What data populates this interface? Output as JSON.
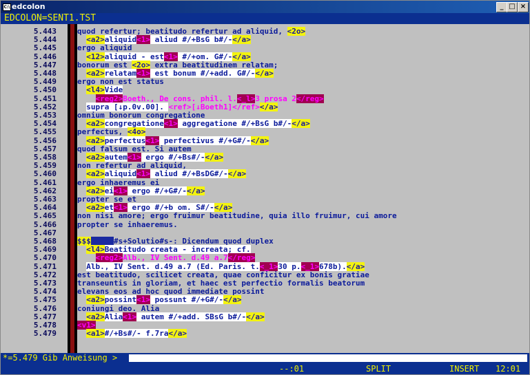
{
  "window": {
    "title": "edcolon",
    "icon_label": "C:\\",
    "controls": [
      "_",
      "□",
      "×"
    ]
  },
  "status_line": "EDCOLON=SENT1.TST",
  "lines": [
    {
      "num": "5.443",
      "segs": [
        {
          "s": "n",
          "t": "quod refertur; beatitudo refertur ad aliquid, "
        },
        {
          "s": "y",
          "t": "<2o>"
        }
      ]
    },
    {
      "num": "5.444",
      "segs": [
        {
          "s": "n",
          "t": "  "
        },
        {
          "s": "y",
          "t": "<a2>"
        },
        {
          "s": "w",
          "t": "aliquid"
        },
        {
          "s": "pb",
          "t": "<1>"
        },
        {
          "s": "w",
          "t": " aliud #/+BsG b#/-"
        },
        {
          "s": "y",
          "t": "</a>"
        }
      ]
    },
    {
      "num": "5.445",
      "segs": [
        {
          "s": "n",
          "t": "ergo aliquid"
        }
      ]
    },
    {
      "num": "5.446",
      "segs": [
        {
          "s": "n",
          "t": "  "
        },
        {
          "s": "y",
          "t": "<12>"
        },
        {
          "s": "w",
          "t": "aliquid - est"
        },
        {
          "s": "pb",
          "t": "<1>"
        },
        {
          "s": "w",
          "t": " #/+om. G#/-"
        },
        {
          "s": "y",
          "t": "</a>"
        }
      ]
    },
    {
      "num": "5.447",
      "segs": [
        {
          "s": "n",
          "t": "bonorum est "
        },
        {
          "s": "y",
          "t": "<2o>"
        },
        {
          "s": "n",
          "t": " extra beatitudinem relatam;"
        }
      ]
    },
    {
      "num": "5.448",
      "segs": [
        {
          "s": "n",
          "t": "  "
        },
        {
          "s": "y",
          "t": "<a2>"
        },
        {
          "s": "w",
          "t": "relatam"
        },
        {
          "s": "pb",
          "t": "<1>"
        },
        {
          "s": "w",
          "t": " est bonum #/+add. G#/-"
        },
        {
          "s": "y",
          "t": "</a>"
        }
      ]
    },
    {
      "num": "5.449",
      "segs": [
        {
          "s": "n",
          "t": "ergo non est status"
        }
      ]
    },
    {
      "num": "5.450",
      "segs": [
        {
          "s": "n",
          "t": "  "
        },
        {
          "s": "y",
          "t": "<l4>"
        },
        {
          "s": "w",
          "t": "Vide"
        }
      ]
    },
    {
      "num": "5.451",
      "segs": [
        {
          "s": "n",
          "t": "    "
        },
        {
          "s": "pb",
          "t": "<reg2>"
        },
        {
          "s": "p",
          "t": "Boeth., De cons. phil. l."
        },
        {
          "s": "pb",
          "t": "<_l>"
        },
        {
          "s": "p",
          "t": "3 prosa 2"
        },
        {
          "s": "pb",
          "t": "</reg>"
        }
      ]
    },
    {
      "num": "5.452",
      "segs": [
        {
          "s": "n",
          "t": "  "
        },
        {
          "s": "w",
          "t": "supra [↓p.0v.00]. "
        },
        {
          "s": "p",
          "t": "<ref>[↓Boeth1]</ref>"
        },
        {
          "s": "y",
          "t": "</a>"
        }
      ]
    },
    {
      "num": "5.453",
      "segs": [
        {
          "s": "n",
          "t": "omnium bonorum congregatione"
        }
      ]
    },
    {
      "num": "5.454",
      "segs": [
        {
          "s": "n",
          "t": "  "
        },
        {
          "s": "y",
          "t": "<a2>"
        },
        {
          "s": "w",
          "t": "congregatione"
        },
        {
          "s": "pb",
          "t": "<1>"
        },
        {
          "s": "w",
          "t": " aggregatione #/+BsG b#/-"
        },
        {
          "s": "y",
          "t": "</a>"
        }
      ]
    },
    {
      "num": "5.455",
      "segs": [
        {
          "s": "n",
          "t": "perfectus, "
        },
        {
          "s": "y",
          "t": "<4o>"
        }
      ]
    },
    {
      "num": "5.456",
      "segs": [
        {
          "s": "n",
          "t": "  "
        },
        {
          "s": "y",
          "t": "<a2>"
        },
        {
          "s": "w",
          "t": "perfectus"
        },
        {
          "s": "pb",
          "t": "<1>"
        },
        {
          "s": "w",
          "t": " perfectivus #/+G#/-"
        },
        {
          "s": "y",
          "t": "</a>"
        }
      ]
    },
    {
      "num": "5.457",
      "segs": [
        {
          "s": "n",
          "t": "quod falsum est. Si autem"
        }
      ]
    },
    {
      "num": "5.458",
      "segs": [
        {
          "s": "n",
          "t": "  "
        },
        {
          "s": "y",
          "t": "<a2>"
        },
        {
          "s": "w",
          "t": "autem"
        },
        {
          "s": "pb",
          "t": "<1>"
        },
        {
          "s": "w",
          "t": " ergo #/+Bs#/-"
        },
        {
          "s": "y",
          "t": "</a>"
        }
      ]
    },
    {
      "num": "5.459",
      "segs": [
        {
          "s": "n",
          "t": "non refertur ad aliquid,"
        }
      ]
    },
    {
      "num": "5.460",
      "segs": [
        {
          "s": "n",
          "t": "  "
        },
        {
          "s": "y",
          "t": "<a2>"
        },
        {
          "s": "w",
          "t": "aliquid"
        },
        {
          "s": "pb",
          "t": "<1>"
        },
        {
          "s": "w",
          "t": " aliud #/+BsDG#/-"
        },
        {
          "s": "y",
          "t": "</a>"
        }
      ]
    },
    {
      "num": "5.461",
      "segs": [
        {
          "s": "n",
          "t": "ergo inhaeremus ei"
        }
      ]
    },
    {
      "num": "5.462",
      "segs": [
        {
          "s": "n",
          "t": "  "
        },
        {
          "s": "y",
          "t": "<a2>"
        },
        {
          "s": "w",
          "t": "ei"
        },
        {
          "s": "pb",
          "t": "<1>"
        },
        {
          "s": "w",
          "t": " ergo #/+G#/-"
        },
        {
          "s": "y",
          "t": "</a>"
        }
      ]
    },
    {
      "num": "5.463",
      "segs": [
        {
          "s": "n",
          "t": "propter se et"
        }
      ]
    },
    {
      "num": "5.464",
      "segs": [
        {
          "s": "n",
          "t": "  "
        },
        {
          "s": "y",
          "t": "<a2>"
        },
        {
          "s": "w",
          "t": "et"
        },
        {
          "s": "pb",
          "t": "<1>"
        },
        {
          "s": "w",
          "t": " ergo #/+b om. S#/-"
        },
        {
          "s": "y",
          "t": "</a>"
        }
      ]
    },
    {
      "num": "5.465",
      "segs": [
        {
          "s": "n",
          "t": "non nisi amore; ergo fruimur beatitudine, quia illo fruimur, cui amore"
        }
      ]
    },
    {
      "num": "5.466",
      "segs": [
        {
          "s": "n",
          "t": "propter se inhaeremus."
        }
      ]
    },
    {
      "num": "5.467",
      "segs": []
    },
    {
      "num": "5.468",
      "segs": [
        {
          "s": "y",
          "t": "$$$"
        },
        {
          "s": "bl",
          "t": "     "
        },
        {
          "s": "n",
          "t": "#s+Solutio#s-: Dicendum quod duplex"
        }
      ]
    },
    {
      "num": "5.469",
      "segs": [
        {
          "s": "n",
          "t": "  "
        },
        {
          "s": "y",
          "t": "<l4>"
        },
        {
          "s": "w",
          "t": "Beatitudo creata - increata; cf."
        }
      ]
    },
    {
      "num": "5.470",
      "segs": [
        {
          "s": "n",
          "t": "    "
        },
        {
          "s": "pb",
          "t": "<reg2>"
        },
        {
          "s": "p",
          "t": "Alb., IV Sent. d.49 a.7"
        },
        {
          "s": "pb",
          "t": "</reg>"
        }
      ]
    },
    {
      "num": "5.471",
      "segs": [
        {
          "s": "n",
          "t": "  "
        },
        {
          "s": "w",
          "t": "Alb., IV Sent. d.49 a.7 (Ed. Paris. t."
        },
        {
          "s": "pb",
          "t": "<_1>"
        },
        {
          "s": "w",
          "t": "30 p."
        },
        {
          "s": "pb",
          "t": "<_1>"
        },
        {
          "s": "w",
          "t": "678b)."
        },
        {
          "s": "y",
          "t": "</a>"
        }
      ]
    },
    {
      "num": "5.472",
      "segs": [
        {
          "s": "n",
          "t": "est beatitudo, scilicet creata, quae conficitur ex bonis gratiae"
        }
      ]
    },
    {
      "num": "5.473",
      "segs": [
        {
          "s": "n",
          "t": "transeuntis in gloriam, et haec est perfectio formalis beatorum"
        }
      ]
    },
    {
      "num": "5.474",
      "segs": [
        {
          "s": "n",
          "t": "elevans eos ad hoc quod immediate possint"
        }
      ]
    },
    {
      "num": "5.475",
      "segs": [
        {
          "s": "n",
          "t": "  "
        },
        {
          "s": "y",
          "t": "<a2>"
        },
        {
          "s": "w",
          "t": "possint"
        },
        {
          "s": "pb",
          "t": "<1>"
        },
        {
          "s": "w",
          "t": " possunt #/+G#/-"
        },
        {
          "s": "y",
          "t": "</a>"
        }
      ]
    },
    {
      "num": "5.476",
      "segs": [
        {
          "s": "n",
          "t": "coniungi deo. Alia"
        }
      ]
    },
    {
      "num": "5.477",
      "segs": [
        {
          "s": "n",
          "t": "  "
        },
        {
          "s": "y",
          "t": "<a2>"
        },
        {
          "s": "w",
          "t": "Alia"
        },
        {
          "s": "pb",
          "t": "<1>"
        },
        {
          "s": "w",
          "t": " autem #/+add. SBsG b#/-"
        },
        {
          "s": "y",
          "t": "</a>"
        }
      ]
    },
    {
      "num": "5.478",
      "segs": [
        {
          "s": "pb",
          "t": "<v1>"
        }
      ]
    },
    {
      "num": "5.479",
      "segs": [
        {
          "s": "n",
          "t": "  "
        },
        {
          "s": "y",
          "t": "<a1>"
        },
        {
          "s": "w",
          "t": "#/+Bs#/- f.7ra"
        },
        {
          "s": "y",
          "t": "</a>"
        }
      ]
    }
  ],
  "command": {
    "prompt": "*=5.479  Gib Anweisung >",
    "value": ""
  },
  "mode_line": {
    "col": "--:01",
    "split": "SPLIT",
    "insert": "INSERT",
    "pos": "12:01"
  }
}
